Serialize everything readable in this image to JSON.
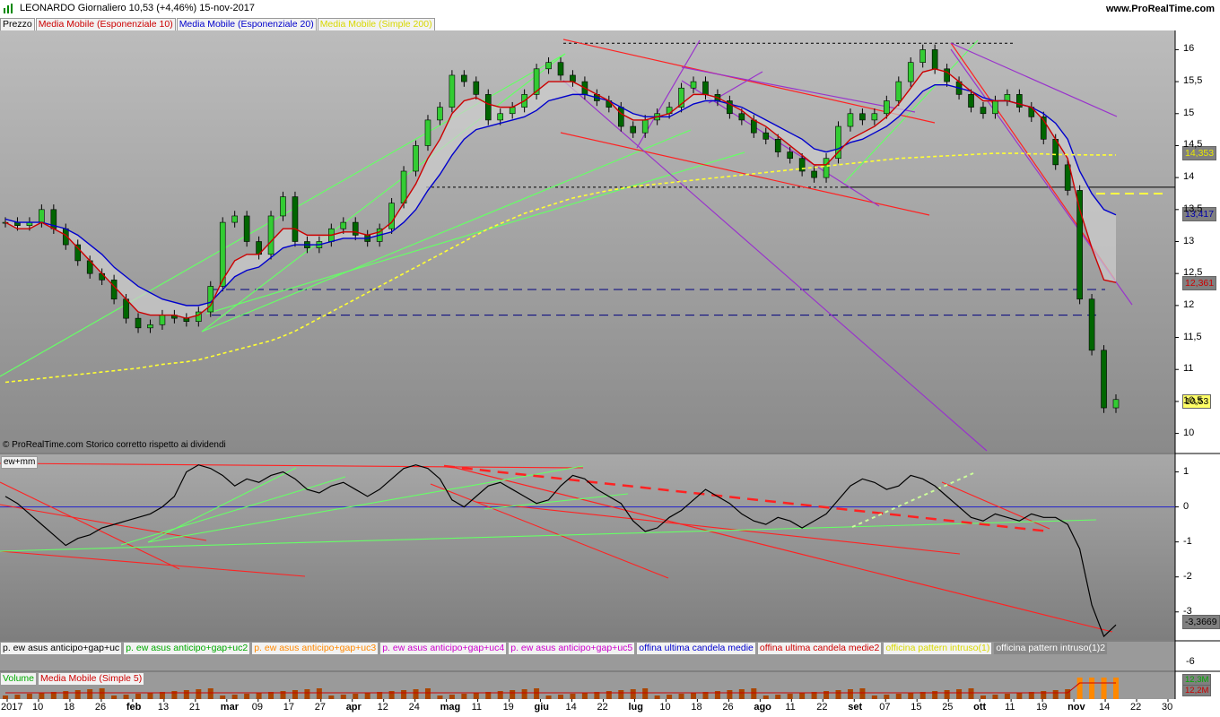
{
  "header": {
    "title": "LEONARDO   Giornaliero   10,53 (+4,46%)   15-nov-2017",
    "site": "www.ProRealTime.com"
  },
  "legend": {
    "items": [
      {
        "label": "Prezzo",
        "color": "#000000"
      },
      {
        "label": "Media Mobile (Esponenziale 10)",
        "color": "#cc0000"
      },
      {
        "label": "Media Mobile (Esponenziale 20)",
        "color": "#0000cc"
      },
      {
        "label": "Media Mobile (Simple 200)",
        "color": "#e8e800"
      }
    ]
  },
  "footnote": "© ProRealTime.com  Storico corretto rispetto ai dividendi",
  "indicator": {
    "label": "ew+mm",
    "badge": "-3,3669"
  },
  "signals_legend": [
    {
      "label": "p. ew asus anticipo+gap+uc",
      "color": "#000000"
    },
    {
      "label": "p. ew asus anticipo+gap+uc2",
      "color": "#00aa00"
    },
    {
      "label": "p. ew asus anticipo+gap+uc3",
      "color": "#ff8800"
    },
    {
      "label": "p. ew asus anticipo+gap+uc4",
      "color": "#cc00cc"
    },
    {
      "label": "p. ew asus anticipo+gap+uc5",
      "color": "#cc00cc"
    },
    {
      "label": "offina ultima candela medie",
      "color": "#0000cc"
    },
    {
      "label": "offina ultima candela medie2",
      "color": "#cc0000"
    },
    {
      "label": "officina pattern intruso(1)",
      "color": "#e8e800"
    },
    {
      "label": "officina pattern intruso(1)2",
      "color": "#ffffff"
    }
  ],
  "signals_badge": "-6",
  "volume": {
    "legend": [
      {
        "label": "Volume",
        "color": "#00aa00"
      },
      {
        "label": "Media Mobile (Simple 5)",
        "color": "#cc0000"
      }
    ],
    "badge1": "12,3M",
    "badge2": "12,2M"
  },
  "price_badges": {
    "sma200": "14,353",
    "ema20": "13,417",
    "ema10": "12,361",
    "last": "10,53"
  },
  "chart_data": {
    "type": "line",
    "title": "LEONARDO   Giornaliero   10,53 (+4,46%)   15-nov-2017",
    "xlabel": "",
    "ylabel": "",
    "x_ticks": [
      "2017",
      "10",
      "18",
      "26",
      "feb",
      "13",
      "21",
      "mar",
      "09",
      "17",
      "27",
      "apr",
      "12",
      "24",
      "mag",
      "11",
      "19",
      "giu",
      "14",
      "22",
      "lug",
      "10",
      "18",
      "26",
      "ago",
      "11",
      "22",
      "set",
      "07",
      "15",
      "25",
      "ott",
      "11",
      "19",
      "nov",
      "14",
      "22",
      "30"
    ],
    "y_ticks": [
      10,
      10.5,
      11,
      11.5,
      12,
      12.5,
      13,
      13.5,
      14,
      14.5,
      15,
      15.5,
      16
    ],
    "y_tick_labels": [
      "10",
      "10,5",
      "11",
      "11,5",
      "12",
      "12,5",
      "13",
      "13,5",
      "14",
      "14,5",
      "15",
      "15,5",
      "16"
    ],
    "ylim": [
      9.7,
      16.3
    ],
    "indicator_ticks": [
      -3,
      -2,
      -1,
      0,
      1
    ],
    "indicator_ylim": [
      -3.8,
      1.5
    ],
    "series": [
      {
        "name": "Prezzo",
        "values": [
          13.3,
          13.25,
          13.3,
          13.5,
          13.2,
          12.95,
          12.7,
          12.5,
          12.4,
          12.1,
          11.8,
          11.65,
          11.7,
          11.85,
          11.8,
          11.75,
          11.9,
          12.3,
          13.3,
          13.4,
          13.0,
          12.8,
          13.4,
          13.7,
          13.0,
          12.9,
          13.0,
          13.2,
          13.3,
          13.1,
          13.0,
          13.2,
          13.6,
          14.1,
          14.5,
          14.9,
          15.1,
          15.6,
          15.5,
          15.3,
          14.9,
          15.0,
          15.1,
          15.3,
          15.7,
          15.8,
          15.6,
          15.5,
          15.3,
          15.2,
          15.1,
          14.8,
          14.7,
          14.9,
          15.0,
          15.1,
          15.4,
          15.5,
          15.3,
          15.2,
          15.0,
          14.9,
          14.7,
          14.6,
          14.4,
          14.3,
          14.1,
          14.0,
          14.3,
          14.8,
          15.0,
          14.9,
          15.0,
          15.2,
          15.5,
          15.8,
          16.0,
          15.7,
          15.5,
          15.3,
          15.1,
          15.0,
          15.2,
          15.3,
          15.1,
          14.95,
          14.6,
          14.2,
          13.8,
          12.1,
          11.3,
          10.4,
          10.53
        ]
      },
      {
        "name": "Media Mobile (Esponenziale 10)",
        "values": [
          13.3,
          13.2,
          13.2,
          13.3,
          13.2,
          13.1,
          12.9,
          12.7,
          12.5,
          12.3,
          12.1,
          11.9,
          11.85,
          11.85,
          11.85,
          11.8,
          11.85,
          12.0,
          12.4,
          12.7,
          12.8,
          12.8,
          13.0,
          13.2,
          13.2,
          13.1,
          13.1,
          13.1,
          13.15,
          13.15,
          13.1,
          13.15,
          13.3,
          13.6,
          13.9,
          14.3,
          14.6,
          15.0,
          15.2,
          15.25,
          15.15,
          15.1,
          15.1,
          15.2,
          15.35,
          15.5,
          15.5,
          15.5,
          15.4,
          15.3,
          15.2,
          15.0,
          14.9,
          14.9,
          14.95,
          15.0,
          15.15,
          15.3,
          15.3,
          15.25,
          15.15,
          15.05,
          14.9,
          14.8,
          14.65,
          14.5,
          14.35,
          14.2,
          14.2,
          14.4,
          14.6,
          14.7,
          14.8,
          14.95,
          15.15,
          15.4,
          15.65,
          15.7,
          15.65,
          15.5,
          15.35,
          15.2,
          15.2,
          15.2,
          15.15,
          15.1,
          14.9,
          14.6,
          14.3,
          13.5,
          12.9,
          12.4,
          12.36
        ]
      },
      {
        "name": "Media Mobile (Esponenziale 20)",
        "values": [
          13.35,
          13.3,
          13.3,
          13.3,
          13.25,
          13.2,
          13.1,
          12.95,
          12.8,
          12.6,
          12.45,
          12.3,
          12.2,
          12.1,
          12.05,
          12.0,
          12.0,
          12.05,
          12.25,
          12.45,
          12.55,
          12.6,
          12.75,
          12.9,
          12.95,
          12.95,
          12.95,
          13.0,
          13.05,
          13.05,
          13.05,
          13.1,
          13.15,
          13.3,
          13.5,
          13.8,
          14.05,
          14.35,
          14.6,
          14.75,
          14.8,
          14.85,
          14.9,
          14.95,
          15.05,
          15.2,
          15.25,
          15.3,
          15.3,
          15.25,
          15.2,
          15.1,
          15.0,
          14.95,
          14.95,
          14.95,
          15.05,
          15.15,
          15.2,
          15.2,
          15.15,
          15.1,
          15.0,
          14.9,
          14.8,
          14.7,
          14.6,
          14.45,
          14.4,
          14.45,
          14.55,
          14.6,
          14.7,
          14.8,
          14.95,
          15.15,
          15.35,
          15.45,
          15.45,
          15.4,
          15.35,
          15.25,
          15.2,
          15.2,
          15.15,
          15.1,
          15.0,
          14.85,
          14.6,
          14.1,
          13.75,
          13.5,
          13.417
        ]
      },
      {
        "name": "Media Mobile (Simple 200)",
        "values": [
          10.8,
          10.82,
          10.84,
          10.86,
          10.88,
          10.9,
          10.92,
          10.94,
          10.96,
          10.98,
          11.0,
          11.02,
          11.05,
          11.08,
          11.1,
          11.12,
          11.15,
          11.2,
          11.25,
          11.3,
          11.35,
          11.4,
          11.45,
          11.52,
          11.6,
          11.7,
          11.8,
          11.9,
          12.0,
          12.1,
          12.2,
          12.3,
          12.4,
          12.5,
          12.6,
          12.7,
          12.8,
          12.9,
          13.0,
          13.1,
          13.2,
          13.28,
          13.36,
          13.44,
          13.5,
          13.56,
          13.62,
          13.68,
          13.72,
          13.76,
          13.8,
          13.83,
          13.86,
          13.88,
          13.9,
          13.92,
          13.94,
          13.96,
          13.98,
          14.0,
          14.02,
          14.04,
          14.06,
          14.08,
          14.1,
          14.12,
          14.14,
          14.16,
          14.18,
          14.2,
          14.22,
          14.24,
          14.26,
          14.28,
          14.3,
          14.31,
          14.32,
          14.33,
          14.34,
          14.35,
          14.36,
          14.37,
          14.38,
          14.38,
          14.38,
          14.37,
          14.37,
          14.36,
          14.36,
          14.355,
          14.354,
          14.353,
          14.353
        ]
      },
      {
        "name": "ew+mm",
        "values": [
          0.3,
          0.1,
          -0.2,
          -0.5,
          -0.8,
          -1.1,
          -0.9,
          -0.8,
          -0.6,
          -0.5,
          -0.4,
          -0.3,
          -0.2,
          0.0,
          0.3,
          1.0,
          1.2,
          1.1,
          0.9,
          0.6,
          0.8,
          0.7,
          0.9,
          1.0,
          0.8,
          0.5,
          0.4,
          0.6,
          0.7,
          0.5,
          0.3,
          0.5,
          0.8,
          1.1,
          1.2,
          1.1,
          0.8,
          0.2,
          0.0,
          0.3,
          0.6,
          0.7,
          0.5,
          0.3,
          0.1,
          0.2,
          0.6,
          0.9,
          0.8,
          0.5,
          0.3,
          0.1,
          -0.4,
          -0.7,
          -0.6,
          -0.3,
          -0.1,
          0.2,
          0.5,
          0.3,
          0.1,
          -0.2,
          -0.4,
          -0.5,
          -0.3,
          -0.4,
          -0.6,
          -0.4,
          -0.2,
          0.2,
          0.6,
          0.8,
          0.7,
          0.5,
          0.6,
          0.9,
          0.8,
          0.6,
          0.3,
          0.0,
          -0.3,
          -0.4,
          -0.2,
          -0.3,
          -0.4,
          -0.2,
          -0.3,
          -0.3,
          -0.5,
          -1.2,
          -2.8,
          -3.7,
          -3.37
        ]
      }
    ]
  }
}
